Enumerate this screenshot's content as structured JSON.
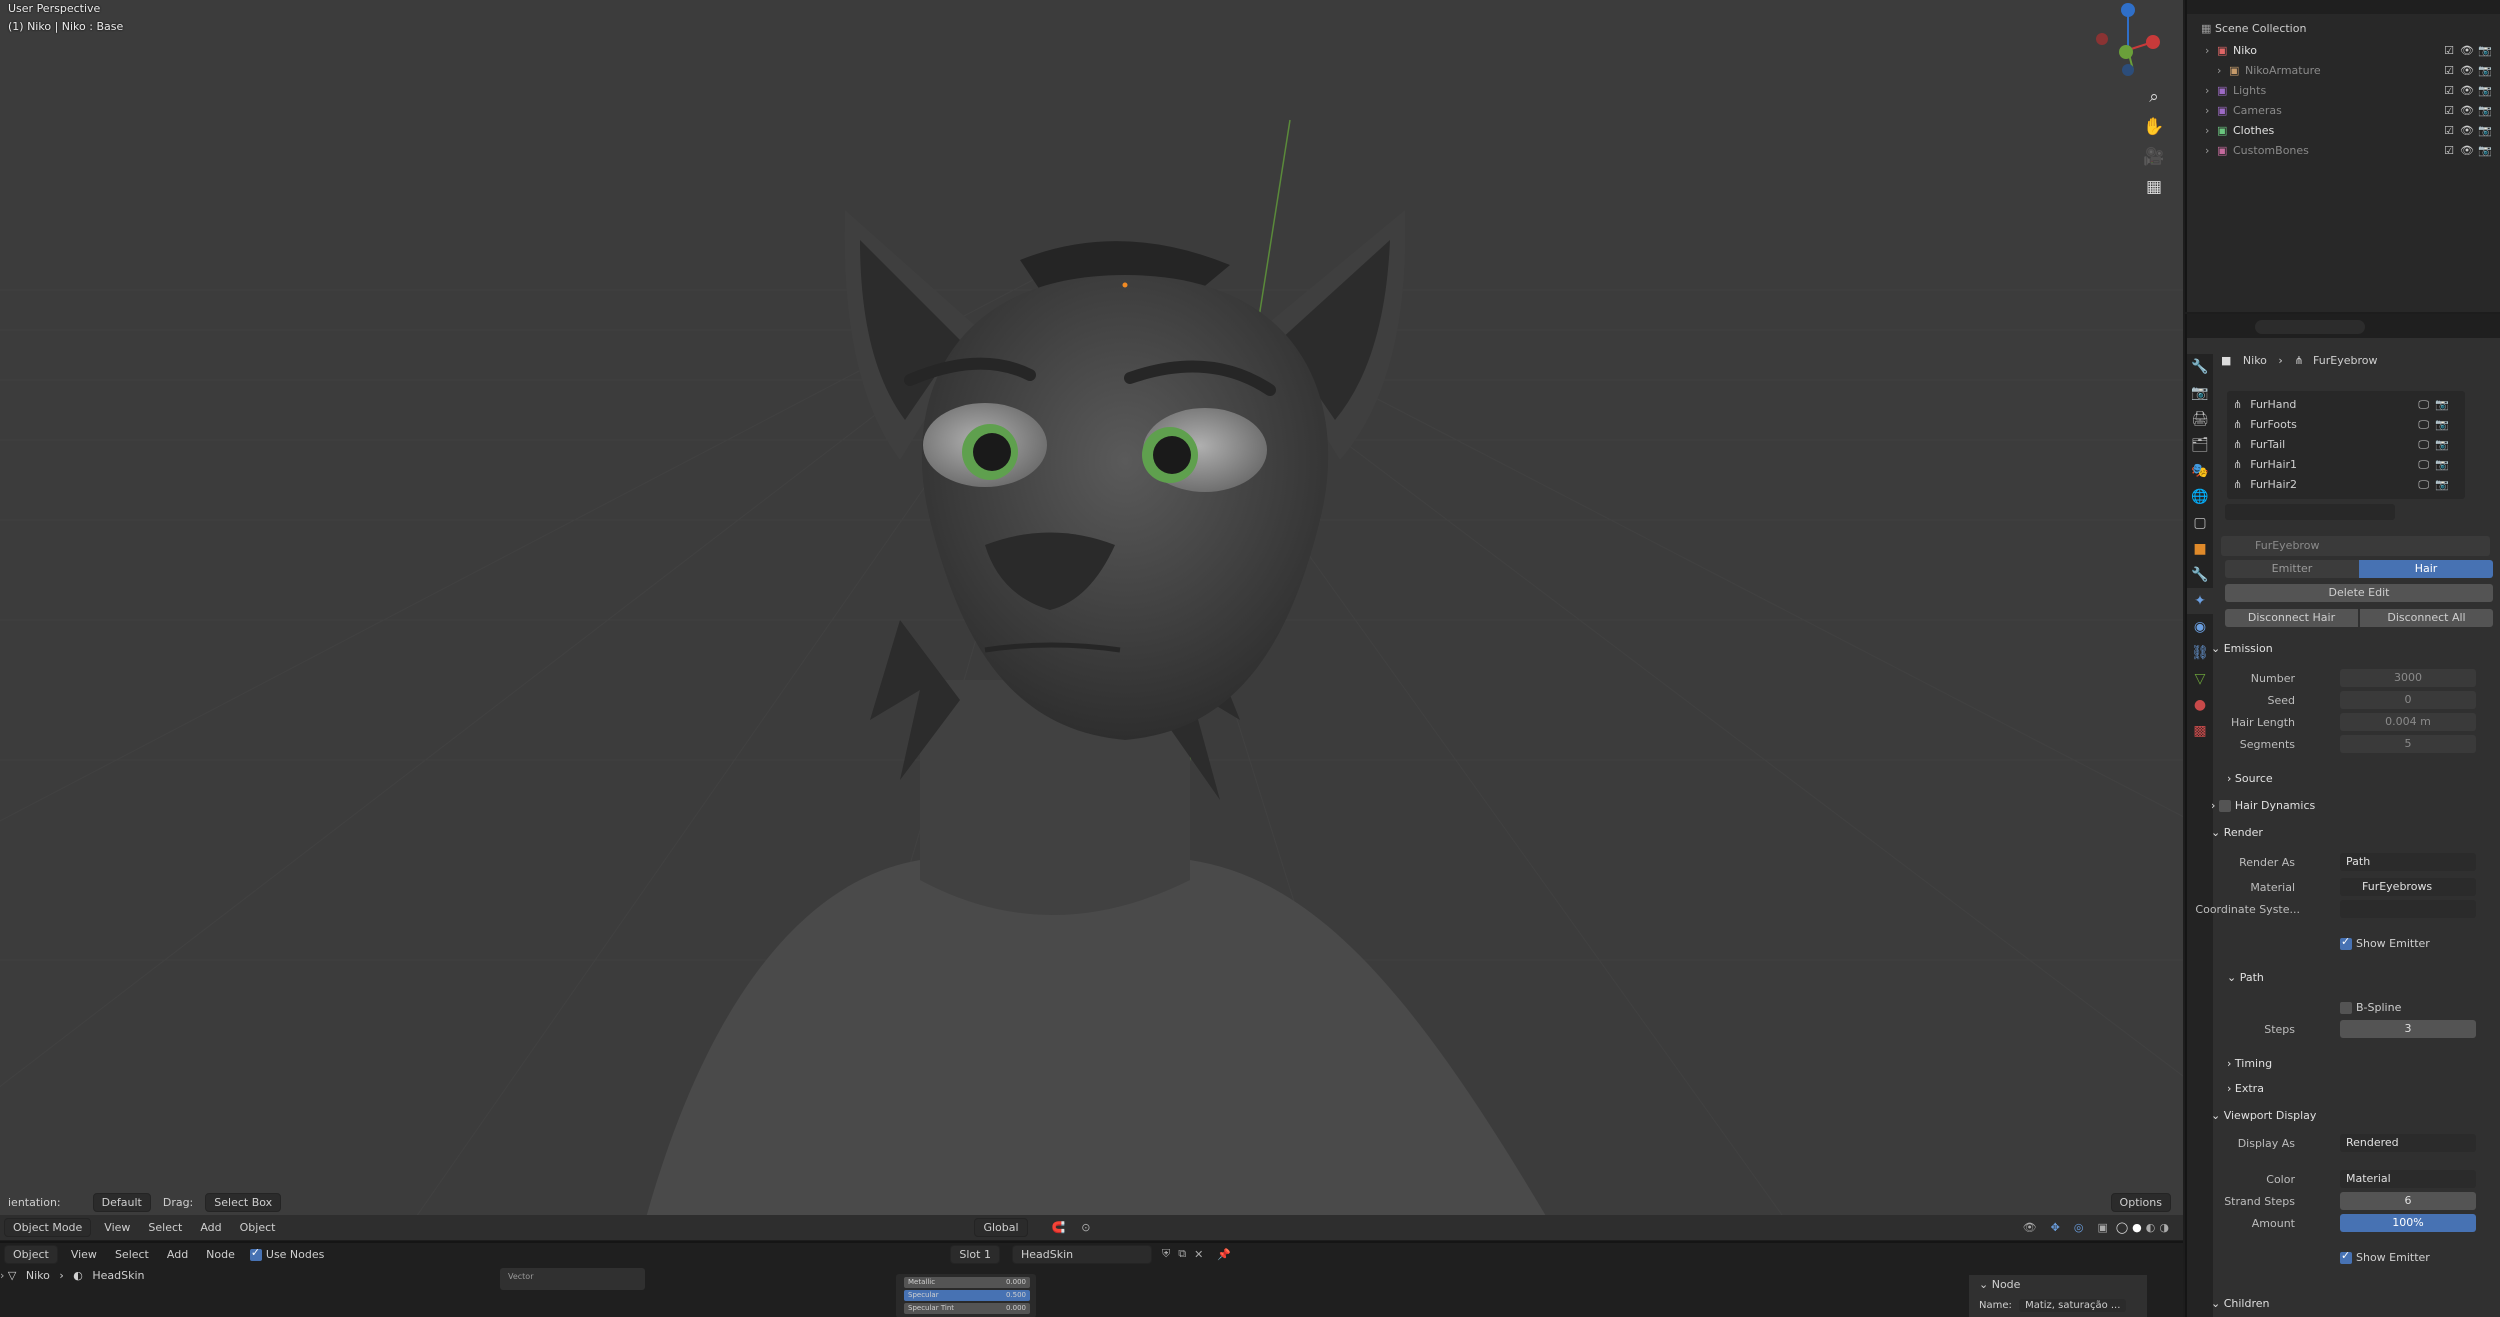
{
  "viewport": {
    "perspective_label": "User Perspective",
    "object_label": "(1) Niko | Niko : Base",
    "header": {
      "orientation_label": "ientation:",
      "orientation_value": "Default",
      "drag_label": "Drag:",
      "drag_value": "Select Box",
      "transform": "Global",
      "options": "Options"
    },
    "menu": {
      "mode": "Object Mode",
      "items": [
        "View",
        "Select",
        "Add",
        "Object"
      ]
    }
  },
  "outliner": {
    "title": "Scene Collection",
    "rows": [
      {
        "name": "Niko",
        "indent": 0,
        "color": "#e06666"
      },
      {
        "name": "NikoArmature",
        "indent": 1,
        "color": "#c59a6a"
      },
      {
        "name": "Lights",
        "indent": 0,
        "color": "#9d6ac5"
      },
      {
        "name": "Cameras",
        "indent": 0,
        "color": "#9d6ac5"
      },
      {
        "name": "Clothes",
        "indent": 0,
        "color": "#6ac57e"
      },
      {
        "name": "CustomBones",
        "indent": 0,
        "color": "#c56a9d"
      }
    ]
  },
  "properties": {
    "breadcrumb": [
      "Niko",
      "FurEyebrow"
    ],
    "particle_list": [
      "FurHand",
      "FurFoots",
      "FurTail",
      "FurHair1",
      "FurHair2"
    ],
    "settings_name": "FurEyebrow",
    "type_tabs": [
      "Emitter",
      "Hair"
    ],
    "active_type": "Hair",
    "delete_edit": "Delete Edit",
    "disconnect_hair": "Disconnect Hair",
    "disconnect_all": "Disconnect All",
    "emission": {
      "title": "Emission",
      "number_label": "Number",
      "number": "3000",
      "seed_label": "Seed",
      "seed": "0",
      "hair_length_label": "Hair Length",
      "hair_length": "0.004 m",
      "segments_label": "Segments",
      "segments": "5"
    },
    "source": "Source",
    "hair_dynamics": "Hair Dynamics",
    "render": {
      "title": "Render",
      "render_as_label": "Render As",
      "render_as": "Path",
      "material_label": "Material",
      "material": "FurEyebrows",
      "coord_label": "Coordinate Syste...",
      "show_emitter": "Show Emitter"
    },
    "path": {
      "title": "Path",
      "bspline": "B-Spline",
      "steps_label": "Steps",
      "steps": "3"
    },
    "timing": "Timing",
    "extra": "Extra",
    "viewport_display": {
      "title": "Viewport Display",
      "display_as_label": "Display As",
      "display_as": "Rendered",
      "color_label": "Color",
      "color": "Material",
      "strand_steps_label": "Strand Steps",
      "strand_steps": "6",
      "amount_label": "Amount",
      "amount": "100%",
      "show_emitter": "Show Emitter"
    },
    "children": "Children"
  },
  "node_editor": {
    "object_dd": "Object",
    "menus": [
      "View",
      "Select",
      "Add",
      "Node"
    ],
    "use_nodes": "Use Nodes",
    "slot": "Slot 1",
    "material": "HeadSkin",
    "breadcrumb": [
      "Niko",
      "HeadSkin"
    ],
    "node_sidebar_title": "Node",
    "name_label": "Name:",
    "name_value": "Matiz, saturação ...",
    "mini_node_rows": [
      {
        "label": "Metallic",
        "value": "0.000"
      },
      {
        "label": "Specular",
        "value": "0.500"
      },
      {
        "label": "Specular Tint",
        "value": "0.000"
      }
    ],
    "vector_label": "Vector"
  },
  "colors": {
    "accent": "#4772b3",
    "viewport_bg": "#3c3c3c",
    "panel_bg": "#303030"
  }
}
